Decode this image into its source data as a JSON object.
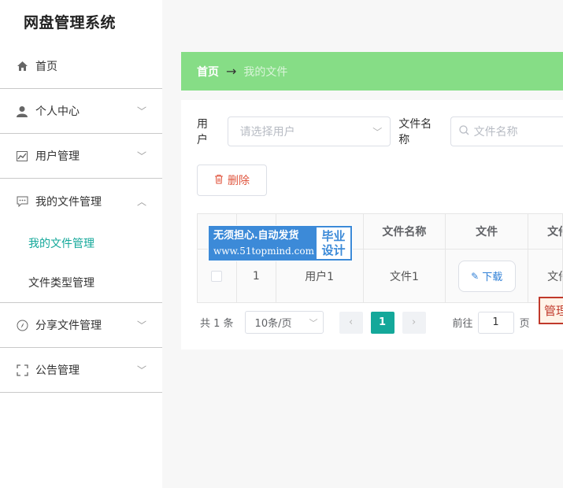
{
  "app": {
    "title": "网盘管理系统"
  },
  "sidebar": {
    "items": [
      {
        "label": "首页",
        "icon": "home-icon"
      },
      {
        "label": "个人中心",
        "icon": "user-icon"
      },
      {
        "label": "用户管理",
        "icon": "chart-icon"
      },
      {
        "label": "我的文件管理",
        "icon": "chat-icon"
      },
      {
        "label": "分享文件管理",
        "icon": "compass-icon"
      },
      {
        "label": "公告管理",
        "icon": "frame-icon"
      }
    ],
    "submenu": [
      {
        "label": "我的文件管理",
        "active": true
      },
      {
        "label": "文件类型管理",
        "active": false
      }
    ],
    "active_color": "#14a89a"
  },
  "breadcrumb": {
    "home": "首页",
    "separator": "→",
    "current": "我的文件",
    "bar_color": "#86dd86"
  },
  "search": {
    "user_label": "用户",
    "user_placeholder": "请选择用户",
    "file_label": "文件名称",
    "file_placeholder": "文件名称"
  },
  "toolbar": {
    "delete_label": "删除"
  },
  "table": {
    "headers": [
      "文件名称",
      "文件",
      "文件"
    ],
    "rows": [
      {
        "index": "1",
        "user": "用户1",
        "name": "文件1",
        "download": "下载",
        "type": "文件"
      }
    ]
  },
  "watermark": {
    "line1": "无须担心.自动发货",
    "line2": "www.51topmind.com",
    "badge1": "毕业",
    "badge2": "设计"
  },
  "pagination": {
    "total": "共 1 条",
    "page_size": "10条/页",
    "current_page": "1",
    "goto_label": "前往",
    "goto_value": "1",
    "page_unit": "页"
  },
  "floating": {
    "manage_label": "管理"
  }
}
